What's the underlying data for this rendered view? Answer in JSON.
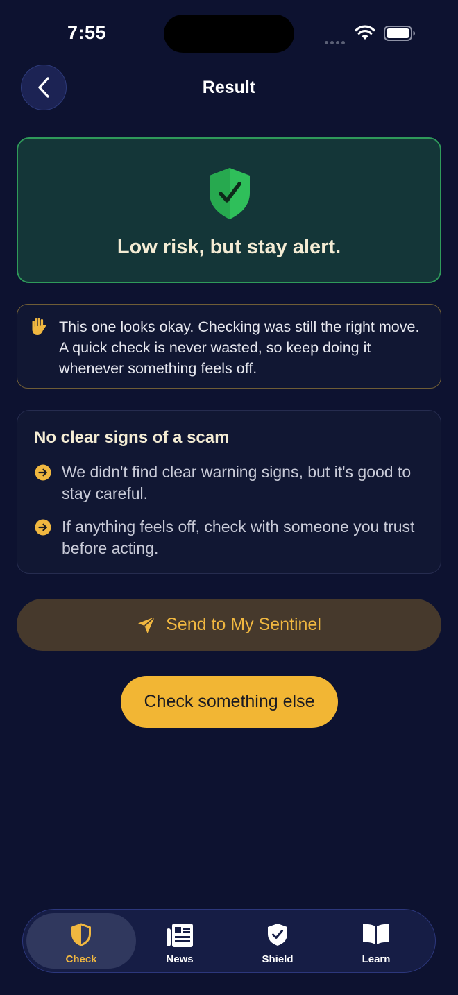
{
  "status_bar": {
    "time": "7:55"
  },
  "header": {
    "title": "Result",
    "back_icon": "chevron-left-icon"
  },
  "result": {
    "risk_text": "Low risk, but stay alert.",
    "icon": "shield-check-icon",
    "accent_color": "#2fbf5a"
  },
  "note": {
    "icon": "hand-icon",
    "text": "This one looks okay. Checking was still the right move. A quick check is never wasted, so keep doing it whenever something feels off."
  },
  "signs": {
    "title": "No clear signs of a scam",
    "items": [
      {
        "icon": "arrow-right-circle-icon",
        "text": "We didn't find clear warning signs, but it's good to stay careful."
      },
      {
        "icon": "arrow-right-circle-icon",
        "text": "If anything feels off, check with someone you trust before acting."
      }
    ]
  },
  "actions": {
    "send_label": "Send to My Sentinel",
    "send_icon": "paper-plane-icon",
    "check_label": "Check something else"
  },
  "tab_bar": {
    "active": "Check",
    "accent_color": "#f0b740",
    "tabs": [
      {
        "label": "Check",
        "icon": "shield-half-icon"
      },
      {
        "label": "News",
        "icon": "newspaper-icon"
      },
      {
        "label": "Shield",
        "icon": "shield-check-icon"
      },
      {
        "label": "Learn",
        "icon": "book-open-icon"
      }
    ]
  }
}
